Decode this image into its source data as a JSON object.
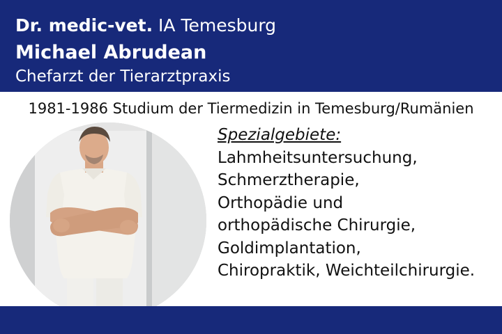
{
  "header": {
    "degree": "Dr. medic-vet.",
    "institution": "IA Temesburg",
    "name": "Michael Abrudean",
    "role": "Chefarzt der Tierarztpraxis"
  },
  "study": "1981-1986 Studium der Tiermedizin in Temesburg/Rumänien",
  "specialties": {
    "heading": "Spezialgebiete:",
    "items": [
      "Lahmheitsuntersuchung,",
      "Schmerztherapie,",
      "Orthopädie und",
      "orthopädische Chirurgie,",
      "Goldimplantation,",
      "Chiropraktik, Weichteilchirurgie."
    ]
  },
  "colors": {
    "band": "#17297a",
    "text": "#111111",
    "header_text": "#ffffff"
  }
}
